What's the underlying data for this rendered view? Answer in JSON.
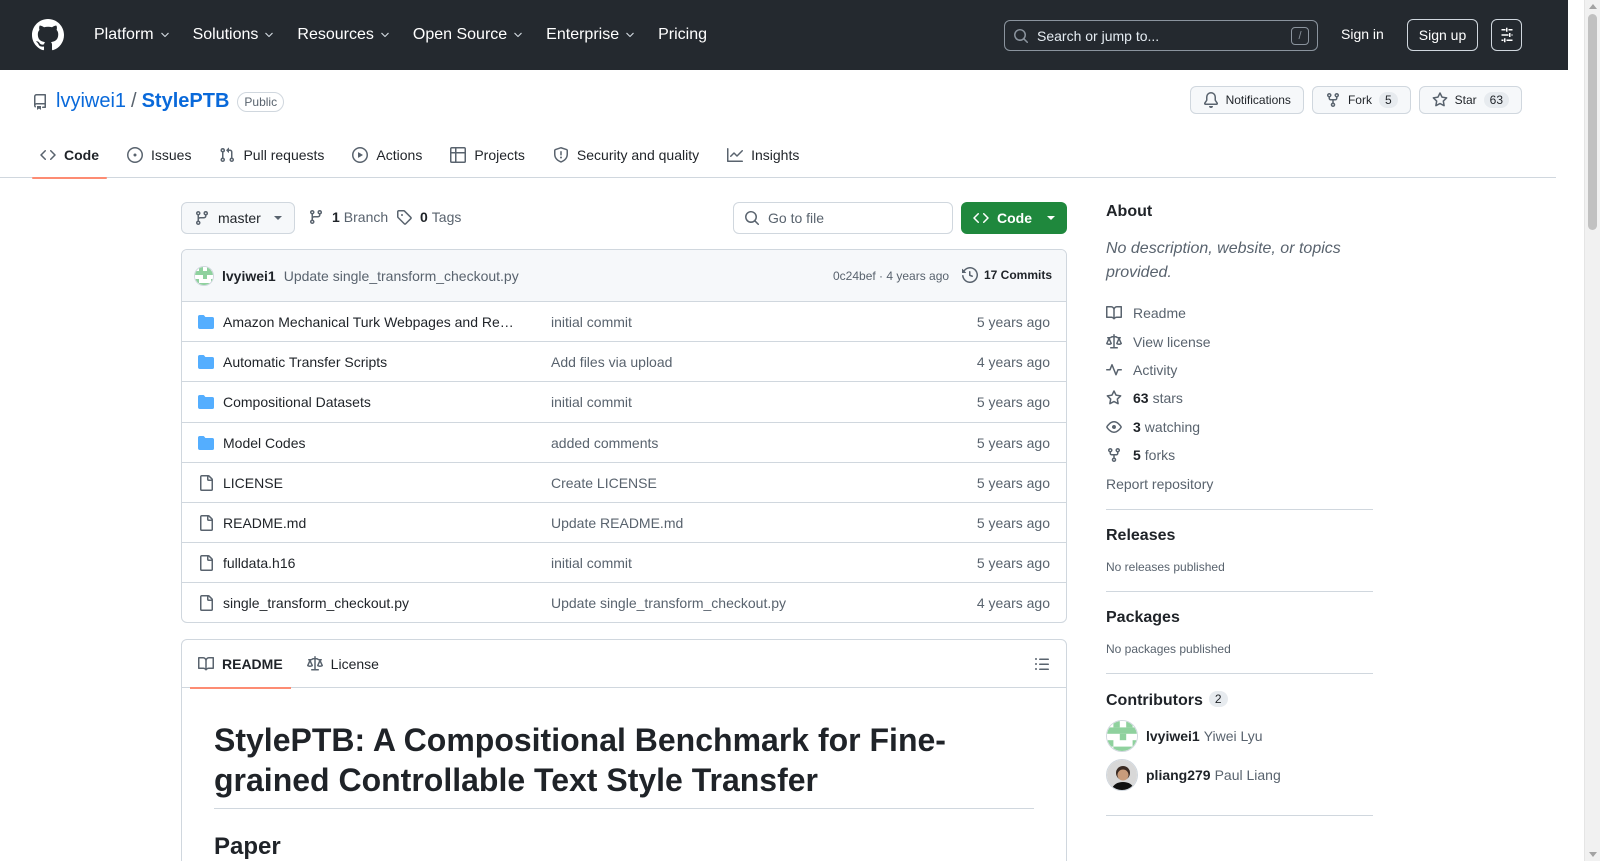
{
  "header": {
    "nav": [
      "Platform",
      "Solutions",
      "Resources",
      "Open Source",
      "Enterprise",
      "Pricing"
    ],
    "search_placeholder": "Search or jump to...",
    "search_shortcut": "/",
    "signin": "Sign in",
    "signup": "Sign up"
  },
  "repo": {
    "owner": "lvyiwei1",
    "separator": "/",
    "name": "StylePTB",
    "visibility": "Public",
    "notifications_label": "Notifications",
    "fork_label": "Fork",
    "fork_count": "5",
    "star_label": "Star",
    "star_count": "63"
  },
  "tabs": [
    {
      "label": "Code",
      "icon": "code-icon",
      "active": true
    },
    {
      "label": "Issues",
      "icon": "issue-icon"
    },
    {
      "label": "Pull requests",
      "icon": "pull-request-icon"
    },
    {
      "label": "Actions",
      "icon": "play-icon"
    },
    {
      "label": "Projects",
      "icon": "table-icon"
    },
    {
      "label": "Security and quality",
      "icon": "shield-icon"
    },
    {
      "label": "Insights",
      "icon": "graph-icon"
    }
  ],
  "toolbar": {
    "branch": "master",
    "branch_count": "1",
    "branch_label": "Branch",
    "tag_count": "0",
    "tag_label": "Tags",
    "goto_placeholder": "Go to file",
    "code_button": "Code"
  },
  "latest_commit": {
    "author": "lvyiwei1",
    "message": "Update single_transform_checkout.py",
    "meta": "0c24bef · 4 years ago",
    "commits": "17 Commits"
  },
  "files": [
    {
      "type": "dir",
      "name": "Amazon Mechanical Turk Webpages and Res…",
      "message": "initial commit",
      "date": "5 years ago"
    },
    {
      "type": "dir",
      "name": "Automatic Transfer Scripts",
      "message": "Add files via upload",
      "date": "4 years ago"
    },
    {
      "type": "dir",
      "name": "Compositional Datasets",
      "message": "initial commit",
      "date": "5 years ago"
    },
    {
      "type": "dir",
      "name": "Model Codes",
      "message": "added comments",
      "date": "5 years ago"
    },
    {
      "type": "file",
      "name": "LICENSE",
      "message": "Create LICENSE",
      "date": "5 years ago"
    },
    {
      "type": "file",
      "name": "README.md",
      "message": "Update README.md",
      "date": "5 years ago"
    },
    {
      "type": "file",
      "name": "fulldata.h16",
      "message": "initial commit",
      "date": "5 years ago"
    },
    {
      "type": "file",
      "name": "single_transform_checkout.py",
      "message": "Update single_transform_checkout.py",
      "date": "4 years ago"
    }
  ],
  "readme": {
    "tab_readme": "README",
    "tab_license": "License",
    "title": "StylePTB: A Compositional Benchmark for Fine-grained Controllable Text Style Transfer",
    "next_heading": "Paper"
  },
  "sidebar": {
    "about_heading": "About",
    "about_desc": "No description, website, or topics provided.",
    "readme": "Readme",
    "license": "View license",
    "activity": "Activity",
    "stars_count": "63",
    "stars_label": "stars",
    "watching_count": "3",
    "watching_label": "watching",
    "forks_count": "5",
    "forks_label": "forks",
    "report": "Report repository",
    "releases_heading": "Releases",
    "releases_text": "No releases published",
    "packages_heading": "Packages",
    "packages_text": "No packages published",
    "contributors_heading": "Contributors",
    "contributors_count": "2",
    "contributors": [
      {
        "login": "lvyiwei1",
        "name": "Yiwei Lyu"
      },
      {
        "login": "pliang279",
        "name": "Paul Liang"
      }
    ]
  },
  "colors": {
    "header_bg": "#24292f",
    "link": "#0969da",
    "primary_button": "#1f883d",
    "active_tab": "#fd8c73",
    "folder": "#54aeff"
  }
}
